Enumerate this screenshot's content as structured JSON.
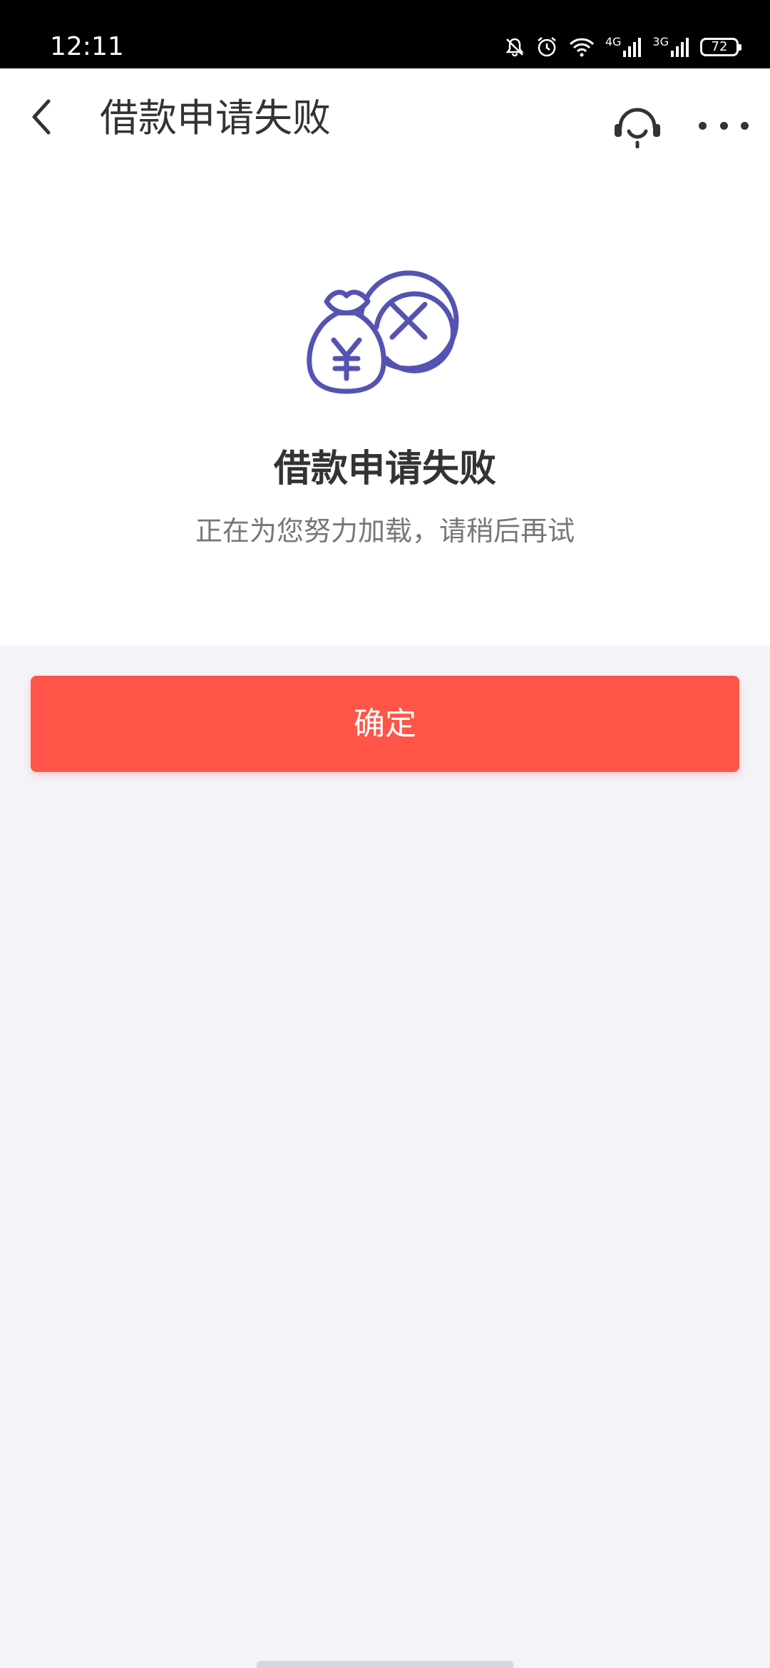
{
  "status_bar": {
    "time": "12:11",
    "battery_level": "72",
    "network_1": "4G",
    "network_2": "3G",
    "icons": [
      "bell-off-icon",
      "alarm-icon",
      "wifi-icon",
      "signal-4g-icon",
      "signal-3g-icon",
      "battery-icon"
    ]
  },
  "app_bar": {
    "title": "借款申请失败",
    "back_icon": "chevron-left-icon",
    "service_icon": "headset-service-icon",
    "more_icon": "more-dots-icon"
  },
  "result": {
    "icon": "money-bag-fail-icon",
    "title": "借款申请失败",
    "description": "正在为您努力加载，请稍后再试"
  },
  "actions": {
    "confirm_label": "确定"
  },
  "colors": {
    "accent": "#ff5549",
    "illustration": "#5553b1",
    "page_background": "#f3f3f8"
  }
}
